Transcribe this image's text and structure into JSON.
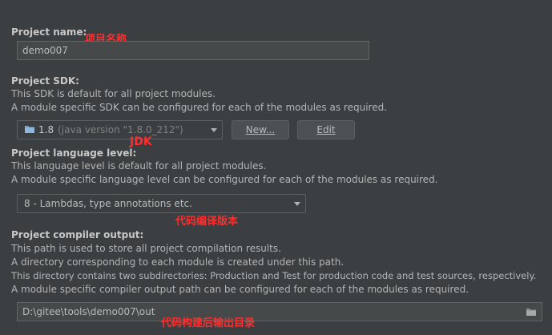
{
  "project_name": {
    "label": "Project name:",
    "annotation": "项目名称",
    "value": "demo007"
  },
  "project_sdk": {
    "label": "Project SDK:",
    "desc_lines": [
      "This SDK is default for all project modules.",
      "A module specific SDK can be configured for each of the modules as required."
    ],
    "selected_version": "1.8",
    "selected_detail": "(java version \"1.8.0_212\")",
    "new_button": "New...",
    "edit_button": "Edit",
    "annotation": "JDK"
  },
  "language_level": {
    "label": "Project language level:",
    "desc_lines": [
      "This language level is default for all project modules.",
      "A module specific language level can be configured for each of the modules as required."
    ],
    "selected": "8 - Lambdas, type annotations etc.",
    "annotation": "代码编译版本"
  },
  "compiler_output": {
    "label": "Project compiler output:",
    "desc_lines": [
      "This path is used to store all project compilation results.",
      "A directory corresponding to each module is created under this path.",
      "This directory contains two subdirectories: Production and Test for production code and test sources, respectively.",
      "A module specific compiler output path can be configured for each of the modules as required."
    ],
    "value": "D:\\gitee\\tools\\demo007\\out",
    "annotation": "代码构建后输出目录"
  },
  "colors": {
    "background": "#3c3f41",
    "field_bg": "#45494a",
    "annotation_red": "#ff2d2d"
  }
}
